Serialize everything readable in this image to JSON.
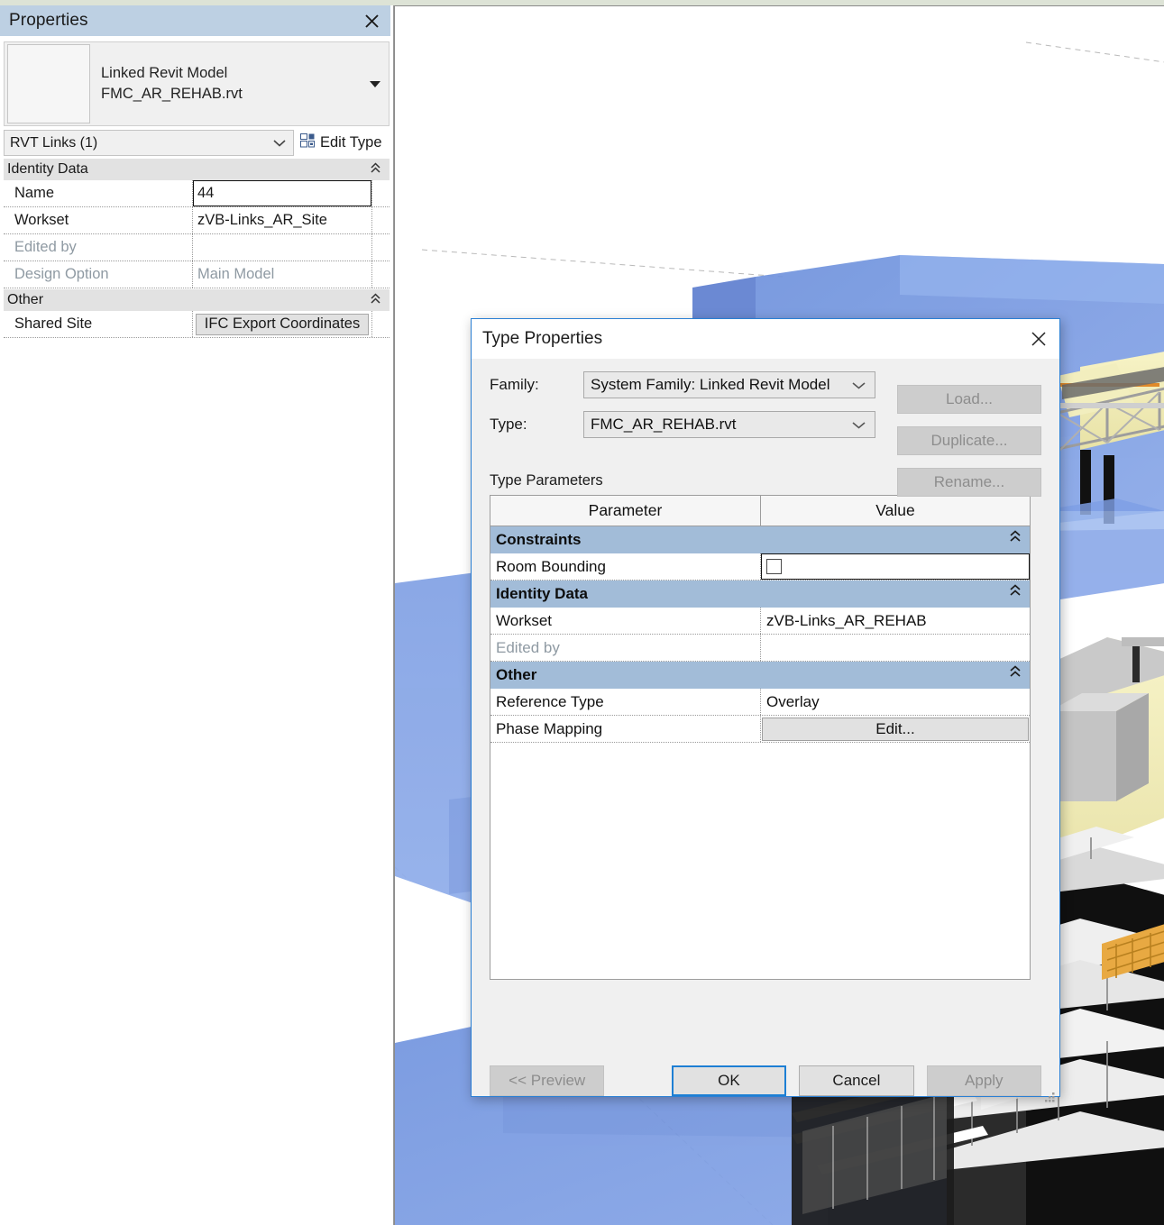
{
  "properties_palette": {
    "title": "Properties",
    "close_icon": "close-icon",
    "type_preview": {
      "family_line": "Linked Revit Model",
      "type_line": "FMC_AR_REHAB.rvt",
      "dropdown_icon": "chevron-down-icon"
    },
    "category_selector": {
      "value": "RVT Links (1)",
      "chevron_icon": "chevron-down-icon"
    },
    "edit_type": {
      "label": "Edit Type",
      "icon": "edit-type-icon"
    },
    "sections": [
      {
        "title": "Identity Data",
        "collapse_icon": "chevron-double-up-icon",
        "rows": [
          {
            "name": "Name",
            "value": "44",
            "state": "active"
          },
          {
            "name": "Workset",
            "value": "zVB-Links_AR_Site",
            "state": "normal"
          },
          {
            "name": "Edited by",
            "value": "",
            "state": "readonly"
          },
          {
            "name": "Design Option",
            "value": "Main Model",
            "state": "readonly"
          }
        ]
      },
      {
        "title": "Other",
        "collapse_icon": "chevron-double-up-icon",
        "rows": [
          {
            "name": "Shared Site",
            "value": "IFC Export Coordinates",
            "state": "button"
          }
        ]
      }
    ]
  },
  "type_properties_dialog": {
    "title": "Type Properties",
    "close_icon": "close-icon",
    "family": {
      "label": "Family:",
      "value": "System Family: Linked Revit Model",
      "chevron_icon": "chevron-down-icon"
    },
    "type": {
      "label": "Type:",
      "value": "FMC_AR_REHAB.rvt",
      "chevron_icon": "chevron-down-icon"
    },
    "side_buttons": [
      {
        "label": "Load...",
        "enabled": false
      },
      {
        "label": "Duplicate...",
        "enabled": false
      },
      {
        "label": "Rename...",
        "enabled": false
      }
    ],
    "parameters_caption": "Type Parameters",
    "table": {
      "columns": [
        "Parameter",
        "Value"
      ],
      "sections": [
        {
          "title": "Constraints",
          "collapse_icon": "chevron-double-up-icon",
          "rows": [
            {
              "name": "Room Bounding",
              "value": "",
              "kind": "checkbox",
              "checked": false,
              "state": "active"
            }
          ]
        },
        {
          "title": "Identity Data",
          "collapse_icon": "chevron-double-up-icon",
          "rows": [
            {
              "name": "Workset",
              "value": "zVB-Links_AR_REHAB",
              "kind": "text",
              "state": "normal"
            },
            {
              "name": "Edited by",
              "value": "",
              "kind": "text",
              "state": "readonly"
            }
          ]
        },
        {
          "title": "Other",
          "collapse_icon": "chevron-double-up-icon",
          "rows": [
            {
              "name": "Reference Type",
              "value": "Overlay",
              "kind": "text",
              "state": "normal"
            },
            {
              "name": "Phase Mapping",
              "value": "Edit...",
              "kind": "button",
              "state": "button"
            }
          ]
        }
      ]
    },
    "footer_buttons": [
      {
        "label": "<< Preview",
        "enabled": false,
        "primary": false
      },
      {
        "label": "OK",
        "enabled": true,
        "primary": true
      },
      {
        "label": "Cancel",
        "enabled": true,
        "primary": false
      },
      {
        "label": "Apply",
        "enabled": false,
        "primary": false
      }
    ],
    "resize_grip_icon": "resize-grip-icon"
  },
  "viewport": {
    "name": "3d-model-view",
    "background": "#ffffff",
    "colors": {
      "site_mass_blue": "#6f92dd",
      "site_mass_blue_light": "#8aa8e8",
      "site_mass_blue_dark": "#4f6fbf",
      "structure_cream": "#f5f0b8",
      "steel_grey": "#b9b9b9",
      "facade_dark": "#1a1a1a",
      "concrete_grey": "#c8c8c8",
      "accent_orange": "#e08a2a"
    }
  }
}
